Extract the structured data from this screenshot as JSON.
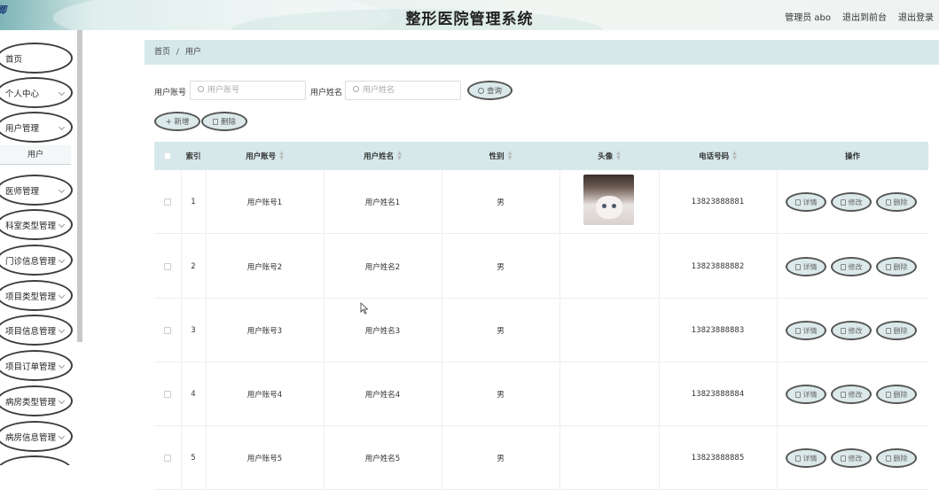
{
  "header": {
    "brand_fragment": "卿",
    "title": "整形医院管理系统",
    "user_label": "管理员 abo",
    "front_link": "退出到前台",
    "logout_link": "退出登录"
  },
  "sidebar": {
    "items": [
      {
        "label": "首页",
        "chevron": false
      },
      {
        "label": "个人中心",
        "chevron": true
      },
      {
        "label": "用户管理",
        "chevron": true
      },
      {
        "label": "医师管理",
        "chevron": true
      },
      {
        "label": "科室类型管理",
        "chevron": true
      },
      {
        "label": "门诊信息管理",
        "chevron": true
      },
      {
        "label": "项目类型管理",
        "chevron": true
      },
      {
        "label": "项目信息管理",
        "chevron": true
      },
      {
        "label": "项目订单管理",
        "chevron": true
      },
      {
        "label": "病房类型管理",
        "chevron": true
      },
      {
        "label": "病房信息管理",
        "chevron": true
      }
    ],
    "submenu_label": "用户"
  },
  "breadcrumb": {
    "home": "首页",
    "separator": "/",
    "current": "用户"
  },
  "search": {
    "account_label": "用户账号",
    "account_placeholder": "用户账号",
    "name_label": "用户姓名",
    "name_placeholder": "用户姓名",
    "query_button": "查询"
  },
  "toolbar": {
    "add_button": "+ 新增",
    "delete_button": "删除"
  },
  "table": {
    "headers": {
      "index": "索引",
      "account": "用户账号",
      "name": "用户姓名",
      "gender": "性别",
      "avatar": "头像",
      "phone": "电话号码",
      "ops": "操作"
    },
    "rows": [
      {
        "index": "1",
        "account": "用户账号1",
        "name": "用户姓名1",
        "gender": "男",
        "phone": "13823888881"
      },
      {
        "index": "2",
        "account": "用户账号2",
        "name": "用户姓名2",
        "gender": "男",
        "phone": "13823888882"
      },
      {
        "index": "3",
        "account": "用户账号3",
        "name": "用户姓名3",
        "gender": "男",
        "phone": "13823888883"
      },
      {
        "index": "4",
        "account": "用户账号4",
        "name": "用户姓名4",
        "gender": "男",
        "phone": "13823888884"
      },
      {
        "index": "5",
        "account": "用户账号5",
        "name": "用户姓名5",
        "gender": "男",
        "phone": "13823888885"
      }
    ],
    "actions": {
      "detail": "详情",
      "edit": "修改",
      "delete": "删除"
    }
  },
  "colors": {
    "accent": "#d6e8ea",
    "button_bg": "#dbe9ea"
  }
}
